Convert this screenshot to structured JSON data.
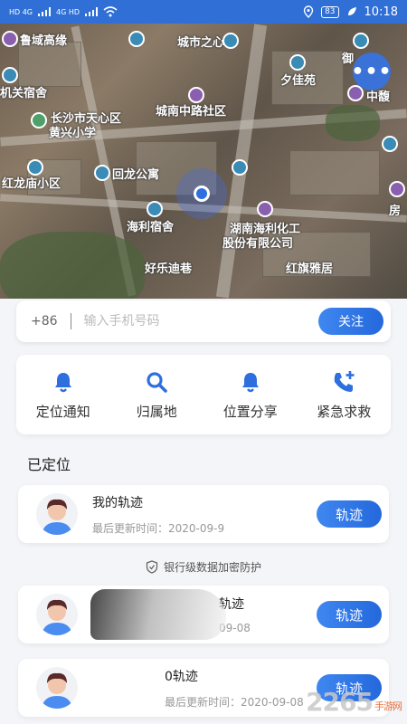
{
  "status_bar": {
    "time": "10:18",
    "battery": "83",
    "net_left": "HD 4G",
    "net_right": "4G HD"
  },
  "map": {
    "labels": [
      "鲁域高缘",
      "城市之心",
      "御",
      "夕佳苑",
      "中馥",
      "机关宿舍",
      "城南中路社区",
      "长沙市天心区",
      "黄兴小学",
      "回龙公寓",
      "红龙庙小区",
      "海利宿舍",
      "湖南海利化工",
      "股份有限公司",
      "好乐迪巷",
      "红旗雅居",
      "房"
    ],
    "more_label": "•••"
  },
  "phone_input": {
    "country_code": "+86",
    "placeholder": "输入手机号码",
    "value": "",
    "follow_label": "关注"
  },
  "features": [
    {
      "label": "定位通知",
      "icon": "bell-icon"
    },
    {
      "label": "归属地",
      "icon": "search-icon"
    },
    {
      "label": "位置分享",
      "icon": "bell-icon"
    },
    {
      "label": "紧急求救",
      "icon": "phone-plus-icon"
    }
  ],
  "located": {
    "title": "已定位",
    "tracks": [
      {
        "name": "我的轨迹",
        "time": "最后更新时间：2020-09-9",
        "button": "轨迹"
      },
      {
        "name": "轨迹",
        "time": "09-08",
        "button": "轨迹"
      },
      {
        "name": "0轨迹",
        "time": "最后更新时间：2020-09-08",
        "button": "轨迹"
      }
    ]
  },
  "security_note": "银行级数据加密防护",
  "watermark": {
    "text": "2265",
    "sub": "手游网"
  },
  "colors": {
    "primary": "#2e6fe0",
    "status_bar": "#2f6fd6"
  }
}
